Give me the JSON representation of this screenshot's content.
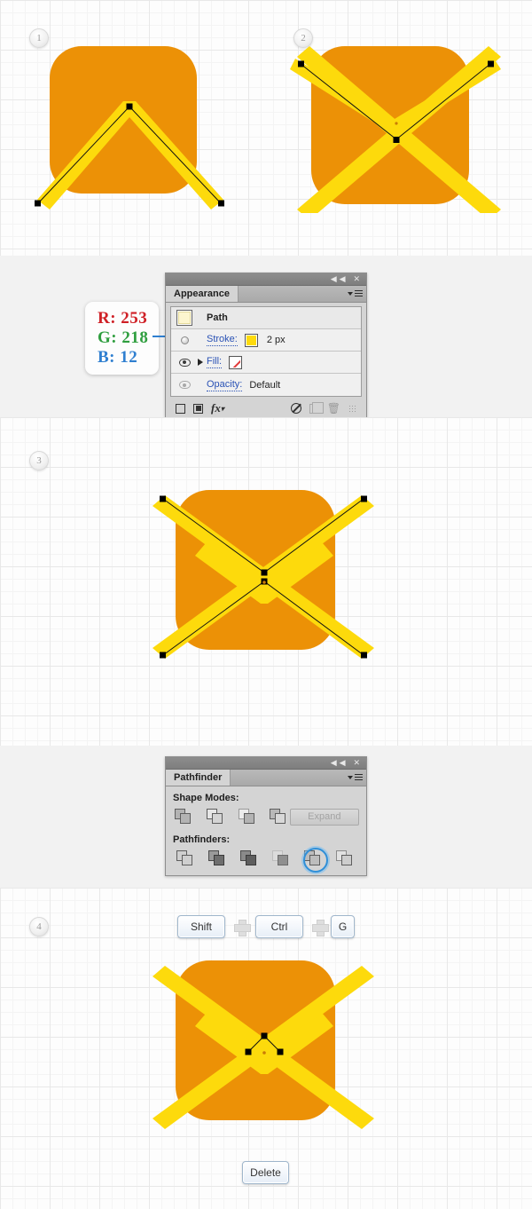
{
  "document": {
    "title": "Adobe Illustrator envelope icon tutorial steps"
  },
  "steps": [
    {
      "number": "1"
    },
    {
      "number": "2"
    },
    {
      "number": "3"
    },
    {
      "number": "4"
    }
  ],
  "colors": {
    "icon_body_orange": "#EC9106",
    "icon_stroke_yellow": "#FDDA0C",
    "canvas_background": "#FDFDFD",
    "grid_line_minor": "#F4F4F4",
    "grid_line_major": "#E8E8E8",
    "panel_band_background": "#F2F2F2",
    "panel_face": "#D4D4D4",
    "link_blue": "#2A52B5",
    "highlight_blue": "#2F8FD8"
  },
  "callout": {
    "label_r": "R: 253",
    "label_g": "G: 218",
    "label_b": "B: 12"
  },
  "appearance_panel": {
    "title_tab": "Appearance",
    "titlebar_icons": [
      "collapse-icon",
      "close-icon"
    ],
    "rows": [
      {
        "id": "path",
        "label": "Path",
        "thumbnail": "path-thumbnail"
      },
      {
        "id": "stroke",
        "label": "Stroke:",
        "value": "2 px",
        "swatch": "#FDDA0C",
        "visibility_icon": "disc-icon"
      },
      {
        "id": "fill",
        "label": "Fill:",
        "value": "",
        "swatch": "none",
        "visibility_icon": "eye-icon"
      },
      {
        "id": "opacity",
        "label": "Opacity:",
        "value": "Default",
        "visibility_icon": "eye-icon-dim"
      }
    ],
    "footer_icons": [
      "add-new-stroke-icon",
      "add-new-fill-icon",
      "add-new-effect-icon",
      "clear-appearance-icon",
      "duplicate-item-icon",
      "delete-item-icon",
      "resize-grip-icon"
    ]
  },
  "pathfinder_panel": {
    "title_tab": "Pathfinder",
    "titlebar_icons": [
      "collapse-icon",
      "close-icon"
    ],
    "shape_modes_label": "Shape Modes:",
    "pathfinders_label": "Pathfinders:",
    "expand_button_label": "Expand",
    "shape_mode_buttons": [
      "unite-icon",
      "minus-front-icon",
      "intersect-icon",
      "exclude-icon"
    ],
    "pathfinder_buttons": [
      "divide-icon",
      "trim-icon",
      "merge-icon",
      "crop-icon",
      "outline-icon",
      "minus-back-icon"
    ],
    "selected_pathfinder_index": 4
  },
  "shortcuts": {
    "group_keys": [
      "Shift",
      "Ctrl",
      "G"
    ],
    "separator": "plus-icon",
    "delete_key": "Delete"
  }
}
